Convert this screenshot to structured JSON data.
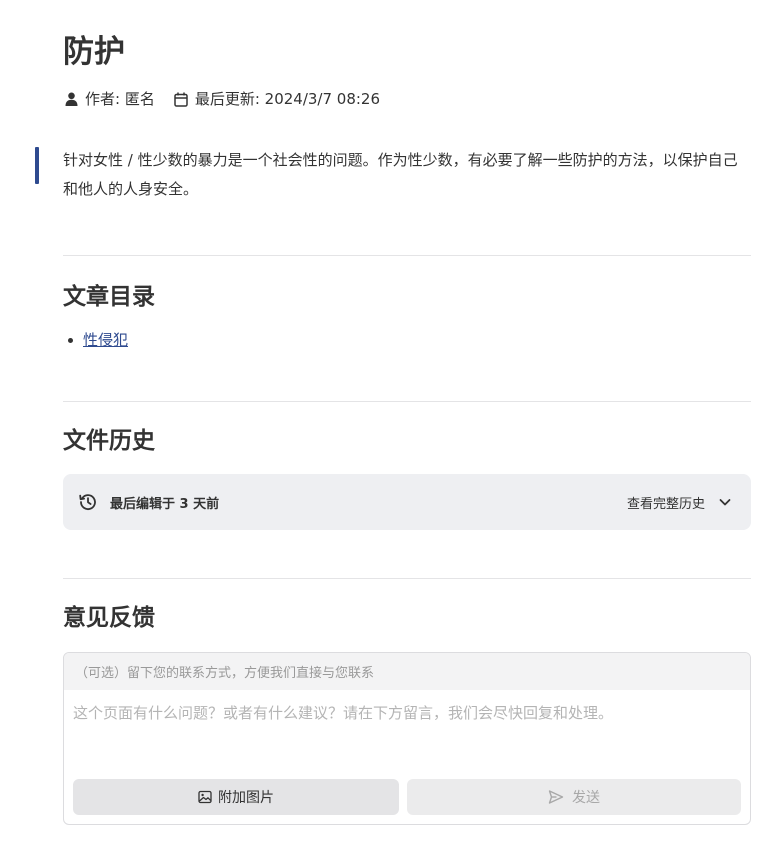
{
  "article": {
    "title": "防护",
    "author_label": "作者: 匿名",
    "updated_label": "最后更新: 2024/3/7 08:26",
    "intro": "针对女性 / 性少数的暴力是一个社会性的问题。作为性少数，有必要了解一些防护的方法，以保护自己和他人的人身安全。"
  },
  "toc": {
    "heading": "文章目录",
    "items": [
      {
        "label": "性侵犯"
      }
    ]
  },
  "history": {
    "heading": "文件历史",
    "last_edited": "最后编辑于 3 天前",
    "view_full": "查看完整历史"
  },
  "feedback": {
    "heading": "意见反馈",
    "contact_placeholder": "（可选）留下您的联系方式，方便我们直接与您联系",
    "message_placeholder": "这个页面有什么问题？或者有什么建议？请在下方留言，我们会尽快回复和处理。",
    "attach_label": "附加图片",
    "send_label": "发送"
  },
  "icons": {
    "author": "user-icon",
    "calendar": "calendar-icon",
    "history": "history-icon",
    "chevron": "chevron-down-icon",
    "image": "image-icon",
    "send": "send-icon"
  },
  "colors": {
    "accent": "#2e4a8f",
    "text": "#333333",
    "panel": "#eeeff2"
  }
}
